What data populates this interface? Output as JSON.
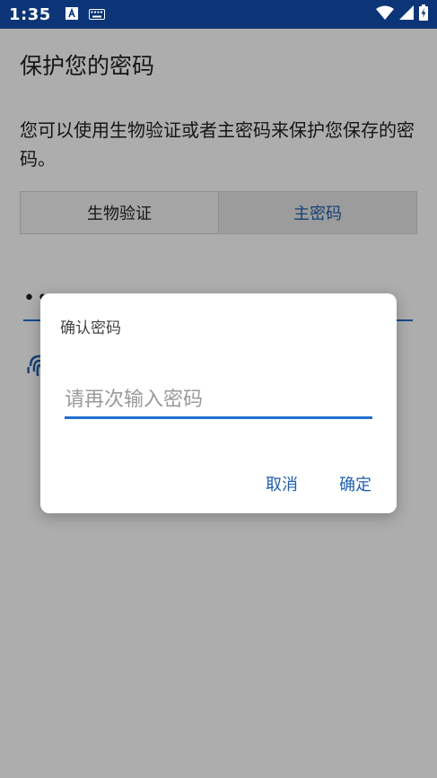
{
  "status_bar": {
    "time": "1:35",
    "icons": [
      "font-a-icon",
      "keyboard-icon",
      "wifi-icon",
      "cell-signal-icon",
      "battery-charging-icon"
    ]
  },
  "page": {
    "title": "保护您的密码",
    "description": "您可以使用生物验证或者主密码来保护您保存的密码。",
    "tabs": [
      {
        "label": "生物验证",
        "selected": false
      },
      {
        "label": "主密码",
        "selected": true
      }
    ],
    "password_field_value": "••"
  },
  "dialog": {
    "title": "确认密码",
    "input_placeholder": "请再次输入密码",
    "cancel_label": "取消",
    "confirm_label": "确定"
  },
  "colors": {
    "status_bar": "#0b3577",
    "accent": "#1f6fd0",
    "button_text": "#1f5fae",
    "scrim": "rgba(0,0,0,0.32)"
  }
}
